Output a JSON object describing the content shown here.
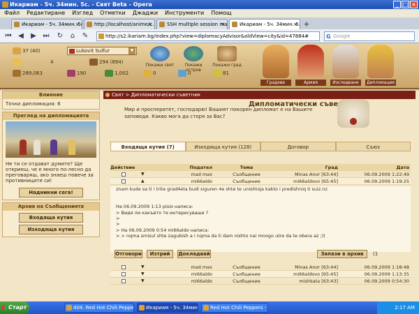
{
  "window": {
    "title": "Икариам - 5ч. 34мин. 5с. - Свят Beta - Opera",
    "menu": [
      "Файл",
      "Редактиране",
      "Изглед",
      "Отметки",
      "Джаджи",
      "Инструменти",
      "Помощ"
    ]
  },
  "browser": {
    "tabs": [
      {
        "label": "Икариам - 5ч. 34мин. 5с."
      },
      {
        "label": "http://localhost/anime/c..."
      },
      {
        "label": "SSH multiple session mana..."
      },
      {
        "label": "Икариам - 5ч. 34мин. 6..."
      }
    ],
    "url": "http://s2.ikariam.bg/index.php?view=diplomacyAdvisor&oldView=city&id=47884#",
    "search_placeholder": "Google"
  },
  "resources": {
    "citizens": "37 (40)",
    "city_name": "Lukovit Sulfur",
    "actions": "4",
    "gold": "294 (894)",
    "wood": "289,063",
    "wine": "190",
    "marble": "1,002",
    "crystal": "0",
    "sulfur": "81",
    "gold2": "0"
  },
  "view_buttons": [
    "Покажи свят",
    "Покажи остров",
    "Покажи град"
  ],
  "advisors": [
    "Градове",
    "Армия",
    "Изследване",
    "Дипломация"
  ],
  "sidebar": {
    "influence_title": "Влияние",
    "diplomacy_points": "Точки дипломация: 6",
    "overview_title": "Преглед на дипломацията",
    "overview_text": "Не ти се отдават думите? Ще откриеш, че е много по-лесно да преговаряш, ако знаеш повече за противниците си!",
    "hire_button": "Надникни сега!",
    "archive_title": "Архив на Съобщенията",
    "inbox_button": "Входяща кутия",
    "outbox_button": "Изходяща кутия"
  },
  "main": {
    "breadcrumb": "Свят > Дипломатически съветник",
    "heading": "Дипломатически съветник",
    "intro": "Мир и просперитет, господарю! Вашият покорен дипломат е на Вашите заповеди. Какво мога да сторя за Вас?",
    "tabs": [
      "Входяща кутия (7)",
      "Изходяща кутия (128)",
      "Договор",
      "Съюз"
    ],
    "columns": [
      "Действие",
      "Подател",
      "Тема",
      "Град",
      "Дата"
    ],
    "top_rows": [
      {
        "from": "mad max",
        "subject": "Съобщение",
        "city": "Minas Anor [63:44]",
        "date": "06.09.2009 1:22:49"
      },
      {
        "from": "mi66aldo",
        "subject": "Съобщение",
        "city": "mi66aldovo [65:45]",
        "date": "06.09.2009 1:19:25"
      }
    ],
    "message_lines": [
      "znam kude sa ti i trite grad4eta budi siguren 4e shte te unishtoja kakto i predishniq ti suiz.nz",
      "",
      "",
      "На 06.09.2009 1:13 pisio написа:",
      "> Видя ли какъвто те интересуваше ?",
      ">",
      ">",
      "> На 06.09.2009 0:54 mi66aldo написа:",
      "> > nqma smisul shte zagubish a i nqma da ti dam nishto nai mnogo utre da te obera az ;))"
    ],
    "msg_buttons": {
      "reply": "Отговори",
      "delete": "Изтрий",
      "report": "Докладвай",
      "archive": "Запази в архив",
      "pager": "(1"
    },
    "bottom_rows": [
      {
        "from": "mad max",
        "subject": "Съобщение",
        "city": "Minas Anor [63:44]",
        "date": "06.09.2009 1:18:48"
      },
      {
        "from": "mi66aldo",
        "subject": "Съобщение",
        "city": "mi66aldovo [65:45]",
        "date": "06.09.2009 1:13:35"
      },
      {
        "from": "mi66aldo",
        "subject": "Съобщение",
        "city": "mishkata [63:43]",
        "date": "06.09.2009 0:54:30"
      }
    ]
  },
  "taskbar": {
    "start": "Старт",
    "tasks": [
      "404. Red Hot Chili Peppers...",
      "Икариам - 5ч. 34мин. ...",
      "Red Hot Chili Peppers - ..."
    ],
    "clock": "2:17 AM"
  }
}
